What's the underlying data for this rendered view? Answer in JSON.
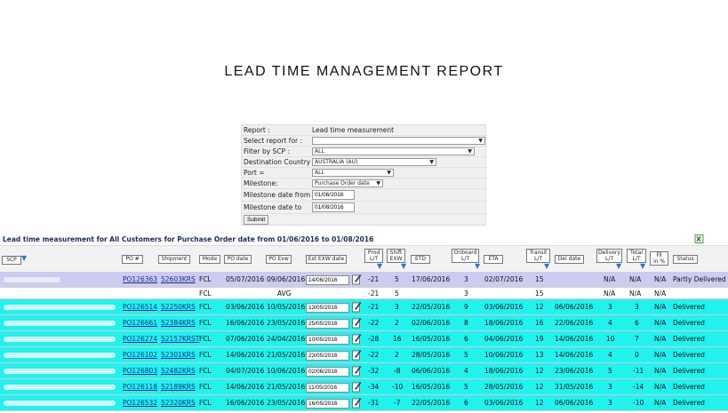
{
  "title": "LEAD TIME MANAGEMENT REPORT",
  "form": {
    "report_label": "Report :",
    "report_value": "Lead time measurement",
    "select_report_label": "Select report for :",
    "select_report_value": "",
    "filter_scp_label": "Filter by SCP :",
    "filter_scp_value": "ALL",
    "dest_country_label": "Destination Country :",
    "dest_country_value": "AUSTRALIA (AU)",
    "port_label": "Port =",
    "port_value": "ALL",
    "milestone_label": "Milestone:",
    "milestone_value": "Purchase Order date",
    "milestone_from_label": "Milestone date from",
    "milestone_from_value": "01/06/2016",
    "milestone_to_label": "Milestone date to",
    "milestone_to_value": "01/08/2016",
    "submit_label": "Submit"
  },
  "caption": "Lead time measurement for All Customers for Purchase Order date from 01/06/2016 to 01/08/2016",
  "columns": {
    "scp": "SCP",
    "po": "PO #",
    "shipment": "Shipment",
    "mode": "Mode",
    "po_date": "PO date",
    "po_exw": "PO Exw",
    "est_exw": "Est EXW date",
    "prod_lt_1": "Prod",
    "prod_lt_2": "L/T",
    "shift_exw_1": "Shift",
    "shift_exw_2": "EXW",
    "etd": "ETD",
    "onboard_lt_1": "Onboard",
    "onboard_lt_2": "L/T",
    "eta": "ETA",
    "transit_lt_1": "Transit",
    "transit_lt_2": "L/T",
    "del_date": "Del date",
    "delivery_lt_1": "Delivery",
    "delivery_lt_2": "L/T",
    "total_lt_1": "Total",
    "total_lt_2": "L/T",
    "fill_1": "Fil",
    "fill_2": "in %",
    "status": "Status"
  },
  "rows": [
    {
      "po": "PO126363",
      "shipment": "52603KRS",
      "mode": "FCL",
      "po_date": "05/07/2016",
      "po_exw": "09/06/2016",
      "est_exw": "14/06/2016",
      "prod": "-21",
      "shift": "5",
      "etd": "17/06/2016",
      "onboard": "3",
      "eta": "02/07/2016",
      "transit": "15",
      "del_date": "",
      "delivery": "N/A",
      "total": "N/A",
      "fill": "N/A",
      "status": "Partly Delivered"
    },
    {
      "po": "",
      "shipment": "",
      "mode": "FCL",
      "po_date": "",
      "po_exw": "AVG",
      "est_exw": "",
      "prod": "-21",
      "shift": "5",
      "etd": "",
      "onboard": "3",
      "eta": "",
      "transit": "15",
      "del_date": "",
      "delivery": "N/A",
      "total": "N/A",
      "fill": "N/A",
      "status": ""
    },
    {
      "po": "PO126514",
      "shipment": "52250KRS",
      "mode": "FCL",
      "po_date": "03/06/2016",
      "po_exw": "10/05/2016",
      "est_exw": "13/05/2016",
      "prod": "-21",
      "shift": "3",
      "etd": "22/05/2016",
      "onboard": "9",
      "eta": "03/06/2016",
      "transit": "12",
      "del_date": "06/06/2016",
      "delivery": "3",
      "total": "3",
      "fill": "N/A",
      "status": "Delivered"
    },
    {
      "po": "PO126661",
      "shipment": "52384KRS",
      "mode": "FCL",
      "po_date": "16/06/2016",
      "po_exw": "23/05/2016",
      "est_exw": "25/05/2016",
      "prod": "-22",
      "shift": "2",
      "etd": "02/06/2016",
      "onboard": "8",
      "eta": "18/06/2016",
      "transit": "16",
      "del_date": "22/06/2016",
      "delivery": "4",
      "total": "6",
      "fill": "N/A",
      "status": "Delivered"
    },
    {
      "po": "PO126274",
      "shipment": "52157KRST",
      "mode": "FCL",
      "po_date": "07/06/2016",
      "po_exw": "24/04/2016",
      "est_exw": "10/05/2016",
      "prod": "-28",
      "shift": "16",
      "etd": "16/05/2016",
      "onboard": "6",
      "eta": "04/06/2016",
      "transit": "19",
      "del_date": "14/06/2016",
      "delivery": "10",
      "total": "7",
      "fill": "N/A",
      "status": "Delivered"
    },
    {
      "po": "PO126102",
      "shipment": "52301KRS",
      "mode": "FCL",
      "po_date": "14/06/2016",
      "po_exw": "21/05/2016",
      "est_exw": "23/05/2016",
      "prod": "-22",
      "shift": "2",
      "etd": "28/05/2016",
      "onboard": "5",
      "eta": "10/06/2016",
      "transit": "13",
      "del_date": "14/06/2016",
      "delivery": "4",
      "total": "0",
      "fill": "N/A",
      "status": "Delivered"
    },
    {
      "po": "PO126803",
      "shipment": "52482KRS",
      "mode": "FCL",
      "po_date": "04/07/2016",
      "po_exw": "10/06/2016",
      "est_exw": "02/06/2016",
      "prod": "-32",
      "shift": "-8",
      "etd": "06/06/2016",
      "onboard": "4",
      "eta": "18/06/2016",
      "transit": "12",
      "del_date": "23/06/2016",
      "delivery": "5",
      "total": "-11",
      "fill": "N/A",
      "status": "Delivered"
    },
    {
      "po": "PO126118",
      "shipment": "52189KRS",
      "mode": "FCL",
      "po_date": "14/06/2016",
      "po_exw": "21/05/2016",
      "est_exw": "11/05/2016",
      "prod": "-34",
      "shift": "-10",
      "etd": "16/05/2016",
      "onboard": "5",
      "eta": "28/05/2016",
      "transit": "12",
      "del_date": "31/05/2016",
      "delivery": "3",
      "total": "-14",
      "fill": "N/A",
      "status": "Delivered"
    },
    {
      "po": "PO126532",
      "shipment": "52320KRS",
      "mode": "FCL",
      "po_date": "16/06/2016",
      "po_exw": "23/05/2016",
      "est_exw": "16/05/2016",
      "prod": "-31",
      "shift": "-7",
      "etd": "22/05/2016",
      "onboard": "6",
      "eta": "03/06/2016",
      "transit": "12",
      "del_date": "06/06/2016",
      "delivery": "3",
      "total": "-10",
      "fill": "N/A",
      "status": "Delivered"
    }
  ],
  "colors": {
    "first_row": "#ccccf0",
    "delivered_row": "#22f2ee",
    "link": "#1a2a8a",
    "sort_arrow": "#3a6fd0"
  },
  "icons": {
    "sort": "sort-arrow-icon",
    "edit": "edit-pencil-icon",
    "excel": "excel-export-icon"
  }
}
